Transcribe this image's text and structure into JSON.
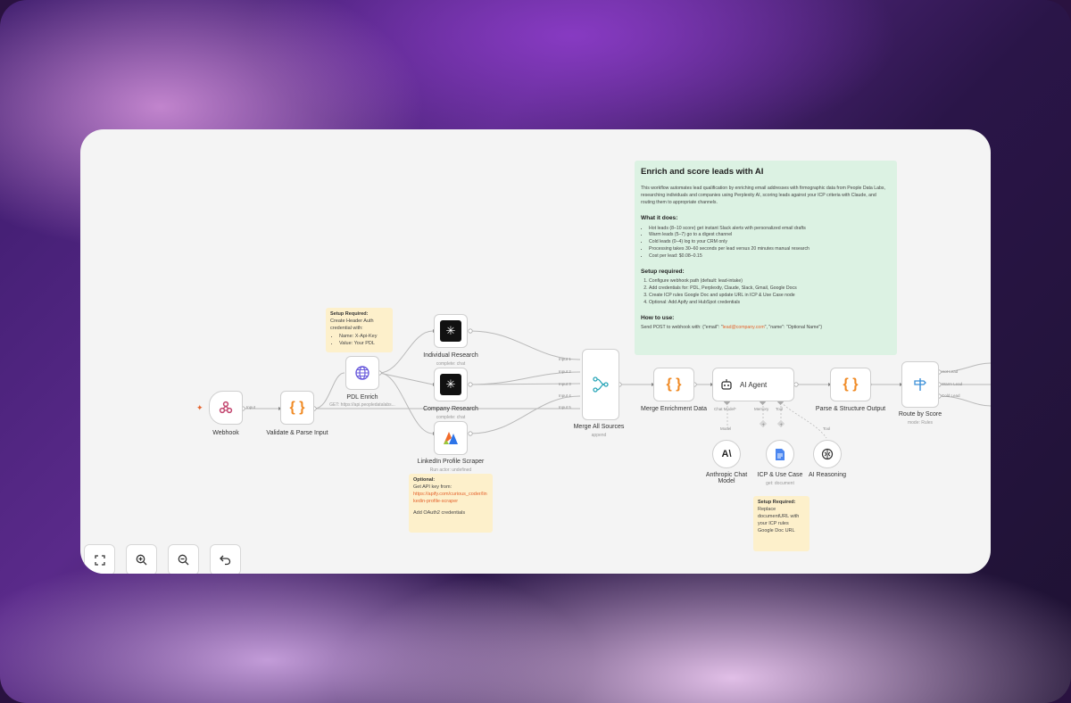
{
  "note_main": {
    "title": "Enrich and score leads with AI",
    "intro": "This workflow automates lead qualification by enriching email addresses with firmographic data from People Data Labs, researching individuals and companies using Perplexity AI, scoring leads against your ICP criteria with Claude, and routing them to appropriate channels.",
    "what_heading": "What it does:",
    "what_items": [
      "Hot leads (8–10 score) get instant Slack alerts with personalized email drafts",
      "Warm leads (5–7) go to a digest channel",
      "Cold leads (0–4) log to your CRM only",
      "Processing takes 30–60 seconds per lead versus 20 minutes manual research",
      "Cost per lead: $0.08–0.15"
    ],
    "setup_heading": "Setup required:",
    "setup_items": [
      "Configure webhook path (default: lead-intake)",
      "Add credentials for: PDL, Perplexity, Claude, Slack, Gmail, Google Docs",
      "Create ICP rules Google Doc and update URL in ICP & Use Case node",
      "Optional: Add Apify and HubSpot credentials"
    ],
    "howto_heading": "How to use:",
    "howto_prefix": "Send POST to webhook with: {\"email\": \"",
    "howto_link": "lead@company.com",
    "howto_suffix": "\", \"name\": \"Optional Name\"}"
  },
  "note_pdl": {
    "heading": "Setup Required:",
    "line1": "Create Header Auth credential with:",
    "items": [
      "Name: X-Api-Key",
      "Value: Your PDL"
    ]
  },
  "note_optional": {
    "heading": "Optional:",
    "line1": "Get API key from:",
    "link": "https://apify.com/curious_coder/linkedin-profile-scraper",
    "line2": "Add OAuth2 credentials"
  },
  "note_icp": {
    "heading": "Setup Required:",
    "body": "Replace documentURL with your ICP rules Google Doc URL"
  },
  "nodes": {
    "webhook": {
      "label": "Webhook"
    },
    "validate": {
      "label": "Validate & Parse Input"
    },
    "pdl": {
      "label": "PDL Enrich",
      "sub": "GET: https://api.peopledatalabs..."
    },
    "individual": {
      "label": "Individual Research",
      "sub": "complete: chat"
    },
    "company": {
      "label": "Company Research",
      "sub": "complete: chat"
    },
    "linkedin": {
      "label": "LinkedIn Profile Scraper",
      "sub": "Run actor: undefined"
    },
    "merge": {
      "label": "Merge All Sources",
      "sub": "append"
    },
    "merge_enrich": {
      "label": "Merge Enrichment Data"
    },
    "agent": {
      "label": "AI Agent"
    },
    "parse": {
      "label": "Parse & Structure Output"
    },
    "route": {
      "label": "Route by Score",
      "sub": "mode: Rules"
    },
    "anthropic": {
      "label": "Anthropic Chat Model"
    },
    "icp": {
      "label": "ICP & Use Case",
      "sub": "get: document"
    },
    "reasoning": {
      "label": "AI Reasoning"
    }
  },
  "ports": {
    "input": "Input",
    "merge_inputs": [
      "Input 1",
      "Input 2",
      "Input 3",
      "Input 4",
      "Input 5"
    ],
    "chat_model": "Chat Model*",
    "memory": "Memory",
    "tool": "Tool",
    "tool2": "Tool",
    "model": "Model",
    "route_outputs": [
      "Hot Lead",
      "Warm Lead",
      "Cold Lead"
    ]
  },
  "toolbar": [
    "fit-view",
    "zoom-in",
    "zoom-out",
    "undo"
  ]
}
